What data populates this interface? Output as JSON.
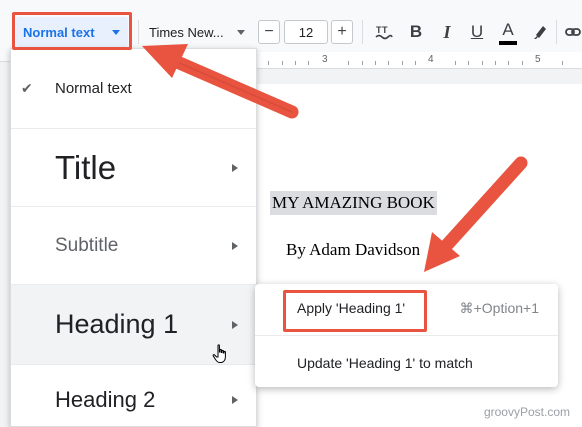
{
  "toolbar": {
    "style_value": "Normal text",
    "font_value": "Times New...",
    "font_size": "12",
    "minus": "−",
    "plus": "+",
    "bold": "B",
    "italic": "I",
    "underline": "U",
    "text_color": "A",
    "icons": [
      "spellcheck-icon",
      "highlight-pen-icon",
      "link-icon"
    ]
  },
  "ruler": {
    "marks": [
      "3",
      "4",
      "5"
    ]
  },
  "style_menu": {
    "items": [
      {
        "label": "Normal text",
        "checked": true
      },
      {
        "label": "Title"
      },
      {
        "label": "Subtitle"
      },
      {
        "label": "Heading 1"
      },
      {
        "label": "Heading 2"
      }
    ]
  },
  "submenu": {
    "apply_label": "Apply 'Heading 1'",
    "apply_shortcut": "⌘+Option+1",
    "update_label": "Update 'Heading 1' to match"
  },
  "document": {
    "title": "MY AMAZING BOOK",
    "author": "By Adam Davidson"
  },
  "watermark": "groovyPost.com",
  "colors": {
    "accent": "#1a73e8",
    "annotation": "#e8543f",
    "selection": "#dadce0"
  }
}
